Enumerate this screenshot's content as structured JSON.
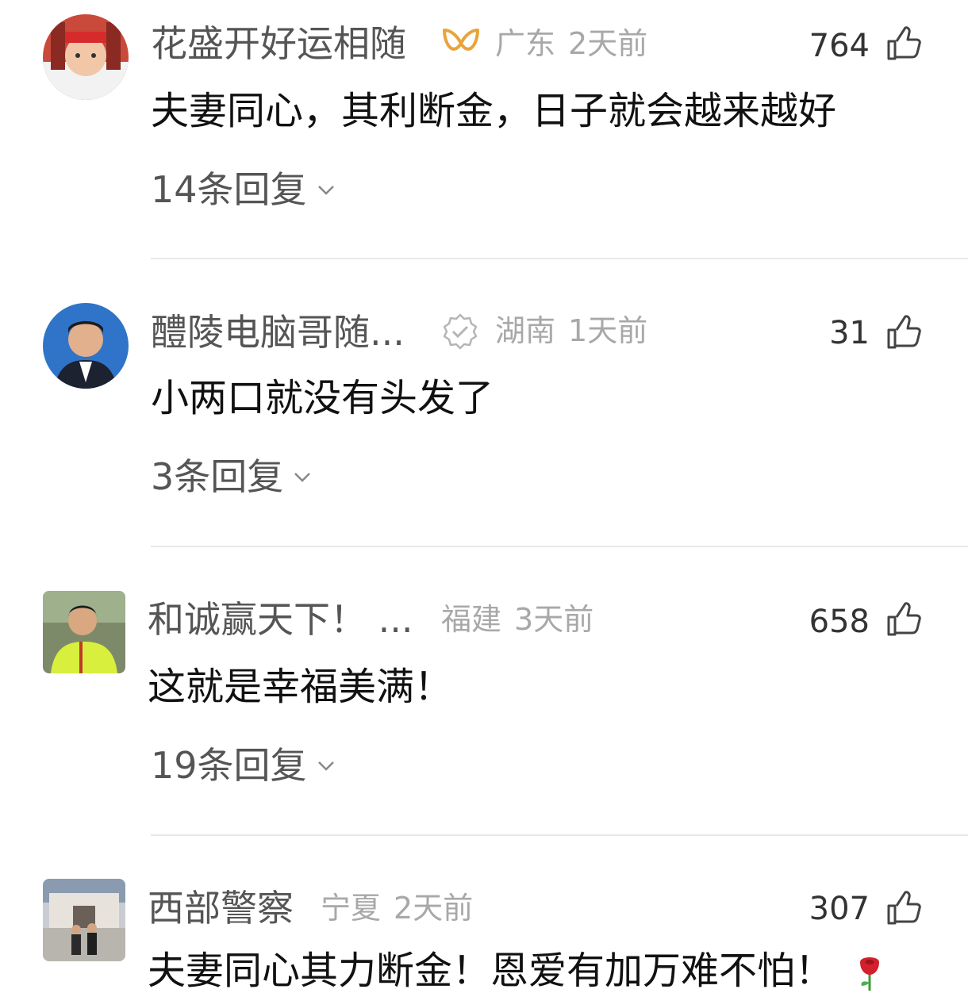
{
  "comments": [
    {
      "username": "花盛开好运相随",
      "region": "广东",
      "time": "2天前",
      "likes": "764",
      "text": "夫妻同心，其利断金，日子就会越来越好",
      "replies": "14条回复"
    },
    {
      "username": "醴陵电脑哥随...",
      "region": "湖南",
      "time": "1天前",
      "likes": "31",
      "text": "小两口就没有头发了",
      "replies": "3条回复"
    },
    {
      "username": "和诚赢天下！ ...",
      "region": "福建",
      "time": "3天前",
      "likes": "658",
      "text": "这就是幸福美满！",
      "replies": "19条回复"
    },
    {
      "username": "西部警察",
      "region": "宁夏",
      "time": "2天前",
      "likes": "307",
      "text": "夫妻同心其力断金！恩爱有加万难不怕！",
      "replies": ""
    }
  ],
  "icons": {
    "like": "thumbs-up-icon",
    "expand": "chevron-down-icon",
    "badge_gold": "gold-ribbon-icon",
    "badge_verified": "verified-badge-icon",
    "emoji": "rose-icon"
  },
  "colors": {
    "username": "#555555",
    "meta": "#a8a8a8",
    "content": "#111111",
    "badge_gold": "#e8a43a",
    "divider": "#e8e8e8"
  }
}
